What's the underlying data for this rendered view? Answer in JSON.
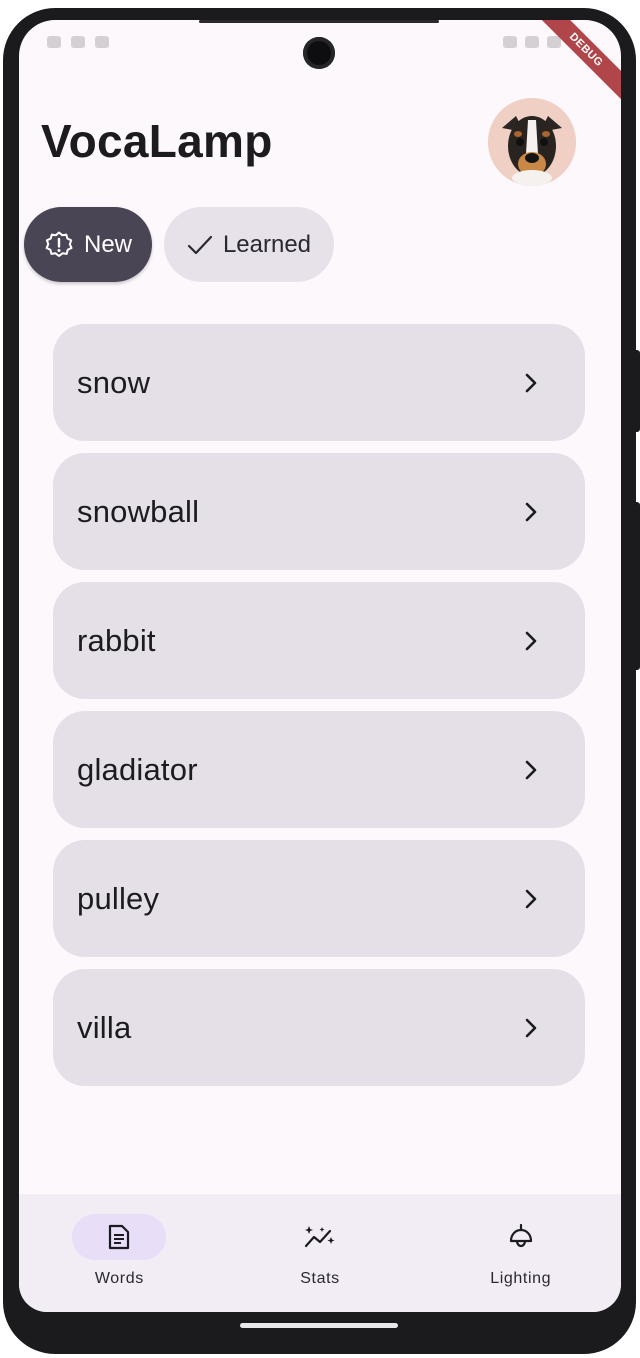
{
  "app": {
    "title": "VocaLamp",
    "debug_label": "DEBUG"
  },
  "filters": [
    {
      "label": "New",
      "icon": "new-badge-icon",
      "selected": true
    },
    {
      "label": "Learned",
      "icon": "check-icon",
      "selected": false
    }
  ],
  "words": [
    {
      "word": "snow"
    },
    {
      "word": "snowball"
    },
    {
      "word": "rabbit"
    },
    {
      "word": "gladiator"
    },
    {
      "word": "pulley"
    },
    {
      "word": "villa"
    }
  ],
  "bottom_nav": [
    {
      "label": "Words",
      "icon": "document-icon",
      "active": true
    },
    {
      "label": "Stats",
      "icon": "sparkle-chart-icon",
      "active": false
    },
    {
      "label": "Lighting",
      "icon": "lamp-icon",
      "active": false
    }
  ],
  "colors": {
    "background": "#fdf8fc",
    "card": "#e5e0e8",
    "chip_selected": "#4a4555",
    "nav_active_pill": "#e8def8",
    "debug_ribbon": "#b0454a"
  }
}
